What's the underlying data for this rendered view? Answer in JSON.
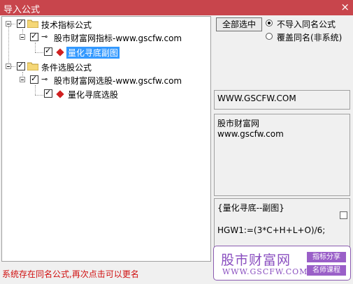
{
  "window": {
    "title": "导入公式",
    "close_glyph": "×"
  },
  "tree": {
    "group1": {
      "label": "技术指标公式",
      "child": {
        "label": "股市财富网指标-www.gscfw.com",
        "leaf": {
          "label": "量化寻底副图"
        }
      }
    },
    "group2": {
      "label": "条件选股公式",
      "child": {
        "label": "股市财富网选股-www.gscfw.com",
        "leaf": {
          "label": "量化寻底选股"
        }
      }
    }
  },
  "options": {
    "select_all": "全部选中",
    "radio1": "不导入同名公式",
    "radio2": "覆盖同名(非系统)"
  },
  "info": {
    "url": "WWW.GSCFW.COM",
    "desc_line1": "股市财富网",
    "desc_line2": "www.gscfw.com",
    "formula_line1": "{量化寻底--副图}",
    "formula_line2": "HGW1:=(3*C+H+L+O)/6;"
  },
  "status": "系统存在同名公式,再次点击可以更名",
  "logo": {
    "name": "股市财富网",
    "url": "WWW.GSCFW.COM",
    "tag1": "指标分享",
    "tag2": "名师课程"
  }
}
